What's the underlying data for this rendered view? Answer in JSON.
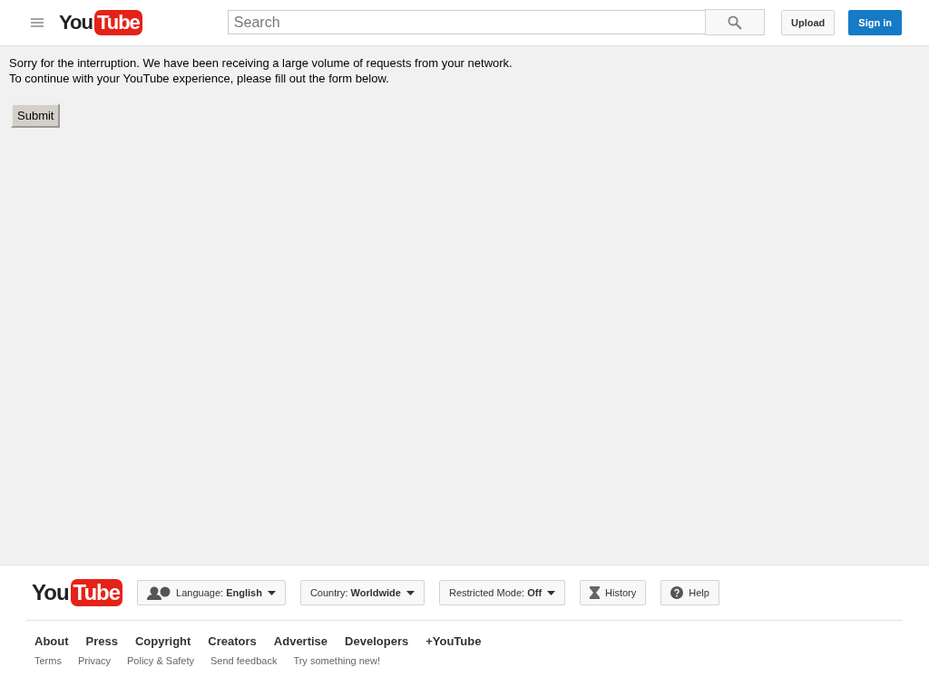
{
  "header": {
    "logo": {
      "you": "You",
      "tube": "Tube"
    },
    "search": {
      "placeholder": "Search"
    },
    "buttons": [
      {
        "label": "Upload",
        "kind": "default"
      },
      {
        "label": "Sign in",
        "kind": "primary"
      }
    ]
  },
  "message": {
    "lines": [
      "Sorry for the interruption. We have been receiving a large volume of requests from your network.",
      "To continue with your YouTube experience, please fill out the form below."
    ],
    "submit": "Submit"
  },
  "footer": {
    "logo": {
      "you": "You",
      "tube": "Tube"
    },
    "buttons": [
      {
        "kind": "language",
        "label": "Language: **English**"
      },
      {
        "kind": "country",
        "label": "Country: **Worldwide**"
      },
      {
        "kind": "restricted",
        "label": "Restricted Mode: **Off**"
      },
      {
        "kind": "history",
        "label": "History"
      },
      {
        "kind": "help",
        "label": "Help"
      }
    ],
    "primary_links": [
      "About",
      "Press",
      "Copyright",
      "Creators",
      "Advertise",
      "Developers",
      "+YouTube"
    ],
    "secondary_links": [
      "Terms",
      "Privacy",
      "Policy & Safety",
      "Send feedback",
      "Try something new!"
    ]
  }
}
